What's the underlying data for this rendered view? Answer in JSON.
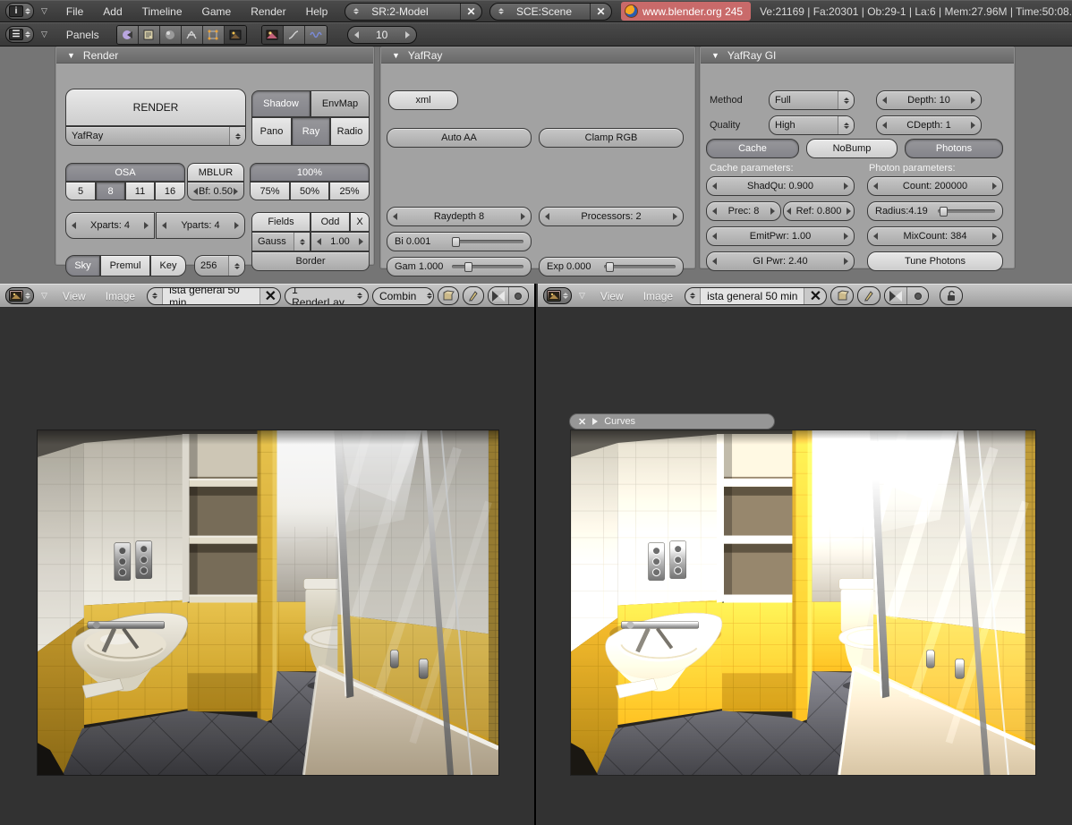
{
  "info_bar": {
    "menus": [
      "File",
      "Add",
      "Timeline",
      "Game",
      "Render",
      "Help"
    ],
    "screen_selector": "SR:2-Model",
    "scene_selector": "SCE:Scene",
    "version_link": "www.blender.org 245",
    "stats": "Ve:21169 | Fa:20301 | Ob:29-1 | La:6  | Mem:27.96M  | Time:50:08.",
    "accent_pink": "#c96a6a"
  },
  "buttons_header": {
    "panels_label": "Panels",
    "frame_value": "10"
  },
  "render_panel": {
    "title": "Render",
    "render_button": "RENDER",
    "engine": "YafRay",
    "shadow": "Shadow",
    "envmap": "EnvMap",
    "pano": "Pano",
    "ray": "Ray",
    "radio": "Radio",
    "osa": "OSA",
    "osa_values": [
      "5",
      "8",
      "11",
      "16"
    ],
    "mblur": "MBLUR",
    "blur_factor": "Bf: 0.50",
    "size_full": "100%",
    "size_values": [
      "75%",
      "50%",
      "25%"
    ],
    "xparts": "Xparts: 4",
    "yparts": "Yparts: 4",
    "fields": "Fields",
    "odd": "Odd",
    "x_toggle": "X",
    "filter_type": "Gauss",
    "filter_size": "1.00",
    "sky": "Sky",
    "premul": "Premul",
    "key": "Key",
    "octree": "256",
    "border": "Border"
  },
  "yafray_panel": {
    "title": "YafRay",
    "xml": "xml",
    "auto_aa": "Auto AA",
    "clamp_rgb": "Clamp RGB",
    "raydepth": "Raydepth 8",
    "processors": "Processors: 2",
    "bias": "Bi 0.001",
    "gamma": "Gam 1.000",
    "exposure": "Exp 0.000"
  },
  "yafray_gi_panel": {
    "title": "YafRay GI",
    "method_label": "Method",
    "method_value": "Full",
    "depth": "Depth: 10",
    "quality_label": "Quality",
    "quality_value": "High",
    "cdepth": "CDepth: 1",
    "cache": "Cache",
    "nobump": "NoBump",
    "photons": "Photons",
    "cache_params_label": "Cache parameters:",
    "photon_params_label": "Photon parameters:",
    "shadqu": "ShadQu: 0.900",
    "count": "Count: 200000",
    "prec": "Prec: 8",
    "ref": "Ref: 0.800",
    "radius": "Radius:4.19",
    "emitpwr": "EmitPwr: 1.00",
    "mixcount": "MixCount: 384",
    "gipwr": "GI Pwr: 2.40",
    "tune_photons": "Tune Photons"
  },
  "image_editor_left": {
    "menus": [
      "View",
      "Image"
    ],
    "image_name": "ista general 50 min.",
    "render_layer": "1 RenderLay",
    "render_pass": "Combin"
  },
  "image_editor_right": {
    "menus": [
      "View",
      "Image"
    ],
    "image_name": "ista general 50 min",
    "curves_panel_label": "Curves"
  }
}
